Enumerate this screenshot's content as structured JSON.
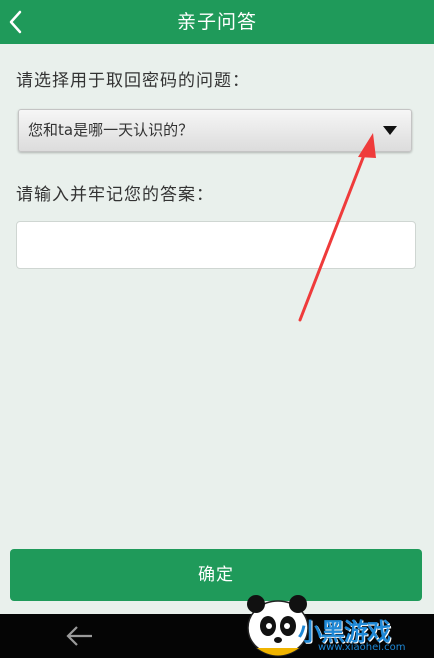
{
  "header": {
    "title": "亲子问答",
    "background": "#1f9a5a"
  },
  "form": {
    "question_label": "请选择用于取回密码的问题：",
    "question_selected": "您和ta是哪一天认识的？",
    "answer_label": "请输入并牢记您的答案：",
    "answer_value": "",
    "confirm_label": "确定"
  },
  "icons": {
    "back": "chevron-left-icon",
    "dropdown": "caret-down-icon",
    "nav_back": "arrow-left-icon"
  },
  "colors": {
    "accent": "#1f9a5a",
    "annotation_arrow": "#ef3b3b",
    "page_background": "#e9f0ec"
  },
  "watermark": {
    "text": "小黑游戏",
    "url": "www.xiaohei.com"
  }
}
